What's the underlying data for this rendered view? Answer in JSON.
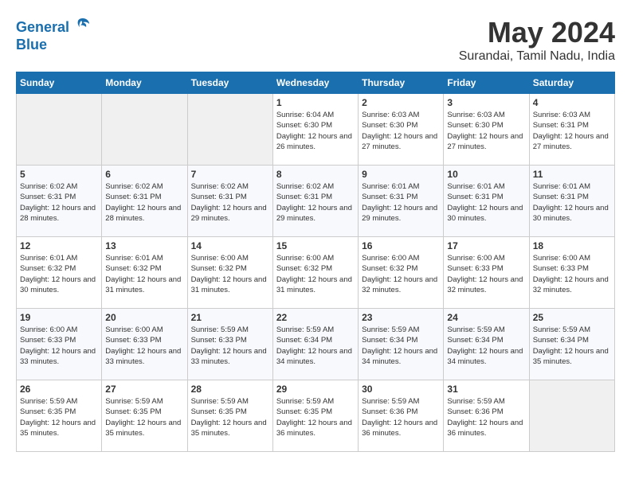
{
  "header": {
    "logo_line1": "General",
    "logo_line2": "Blue",
    "month_title": "May 2024",
    "location": "Surandai, Tamil Nadu, India"
  },
  "weekdays": [
    "Sunday",
    "Monday",
    "Tuesday",
    "Wednesday",
    "Thursday",
    "Friday",
    "Saturday"
  ],
  "weeks": [
    [
      {
        "day": "",
        "empty": true
      },
      {
        "day": "",
        "empty": true
      },
      {
        "day": "",
        "empty": true
      },
      {
        "day": "1",
        "sunrise": "6:04 AM",
        "sunset": "6:30 PM",
        "daylight": "12 hours and 26 minutes."
      },
      {
        "day": "2",
        "sunrise": "6:03 AM",
        "sunset": "6:30 PM",
        "daylight": "12 hours and 27 minutes."
      },
      {
        "day": "3",
        "sunrise": "6:03 AM",
        "sunset": "6:30 PM",
        "daylight": "12 hours and 27 minutes."
      },
      {
        "day": "4",
        "sunrise": "6:03 AM",
        "sunset": "6:31 PM",
        "daylight": "12 hours and 27 minutes."
      }
    ],
    [
      {
        "day": "5",
        "sunrise": "6:02 AM",
        "sunset": "6:31 PM",
        "daylight": "12 hours and 28 minutes."
      },
      {
        "day": "6",
        "sunrise": "6:02 AM",
        "sunset": "6:31 PM",
        "daylight": "12 hours and 28 minutes."
      },
      {
        "day": "7",
        "sunrise": "6:02 AM",
        "sunset": "6:31 PM",
        "daylight": "12 hours and 29 minutes."
      },
      {
        "day": "8",
        "sunrise": "6:02 AM",
        "sunset": "6:31 PM",
        "daylight": "12 hours and 29 minutes."
      },
      {
        "day": "9",
        "sunrise": "6:01 AM",
        "sunset": "6:31 PM",
        "daylight": "12 hours and 29 minutes."
      },
      {
        "day": "10",
        "sunrise": "6:01 AM",
        "sunset": "6:31 PM",
        "daylight": "12 hours and 30 minutes."
      },
      {
        "day": "11",
        "sunrise": "6:01 AM",
        "sunset": "6:31 PM",
        "daylight": "12 hours and 30 minutes."
      }
    ],
    [
      {
        "day": "12",
        "sunrise": "6:01 AM",
        "sunset": "6:32 PM",
        "daylight": "12 hours and 30 minutes."
      },
      {
        "day": "13",
        "sunrise": "6:01 AM",
        "sunset": "6:32 PM",
        "daylight": "12 hours and 31 minutes."
      },
      {
        "day": "14",
        "sunrise": "6:00 AM",
        "sunset": "6:32 PM",
        "daylight": "12 hours and 31 minutes."
      },
      {
        "day": "15",
        "sunrise": "6:00 AM",
        "sunset": "6:32 PM",
        "daylight": "12 hours and 31 minutes."
      },
      {
        "day": "16",
        "sunrise": "6:00 AM",
        "sunset": "6:32 PM",
        "daylight": "12 hours and 32 minutes."
      },
      {
        "day": "17",
        "sunrise": "6:00 AM",
        "sunset": "6:33 PM",
        "daylight": "12 hours and 32 minutes."
      },
      {
        "day": "18",
        "sunrise": "6:00 AM",
        "sunset": "6:33 PM",
        "daylight": "12 hours and 32 minutes."
      }
    ],
    [
      {
        "day": "19",
        "sunrise": "6:00 AM",
        "sunset": "6:33 PM",
        "daylight": "12 hours and 33 minutes."
      },
      {
        "day": "20",
        "sunrise": "6:00 AM",
        "sunset": "6:33 PM",
        "daylight": "12 hours and 33 minutes."
      },
      {
        "day": "21",
        "sunrise": "5:59 AM",
        "sunset": "6:33 PM",
        "daylight": "12 hours and 33 minutes."
      },
      {
        "day": "22",
        "sunrise": "5:59 AM",
        "sunset": "6:34 PM",
        "daylight": "12 hours and 34 minutes."
      },
      {
        "day": "23",
        "sunrise": "5:59 AM",
        "sunset": "6:34 PM",
        "daylight": "12 hours and 34 minutes."
      },
      {
        "day": "24",
        "sunrise": "5:59 AM",
        "sunset": "6:34 PM",
        "daylight": "12 hours and 34 minutes."
      },
      {
        "day": "25",
        "sunrise": "5:59 AM",
        "sunset": "6:34 PM",
        "daylight": "12 hours and 35 minutes."
      }
    ],
    [
      {
        "day": "26",
        "sunrise": "5:59 AM",
        "sunset": "6:35 PM",
        "daylight": "12 hours and 35 minutes."
      },
      {
        "day": "27",
        "sunrise": "5:59 AM",
        "sunset": "6:35 PM",
        "daylight": "12 hours and 35 minutes."
      },
      {
        "day": "28",
        "sunrise": "5:59 AM",
        "sunset": "6:35 PM",
        "daylight": "12 hours and 35 minutes."
      },
      {
        "day": "29",
        "sunrise": "5:59 AM",
        "sunset": "6:35 PM",
        "daylight": "12 hours and 36 minutes."
      },
      {
        "day": "30",
        "sunrise": "5:59 AM",
        "sunset": "6:36 PM",
        "daylight": "12 hours and 36 minutes."
      },
      {
        "day": "31",
        "sunrise": "5:59 AM",
        "sunset": "6:36 PM",
        "daylight": "12 hours and 36 minutes."
      },
      {
        "day": "",
        "empty": true
      }
    ]
  ]
}
